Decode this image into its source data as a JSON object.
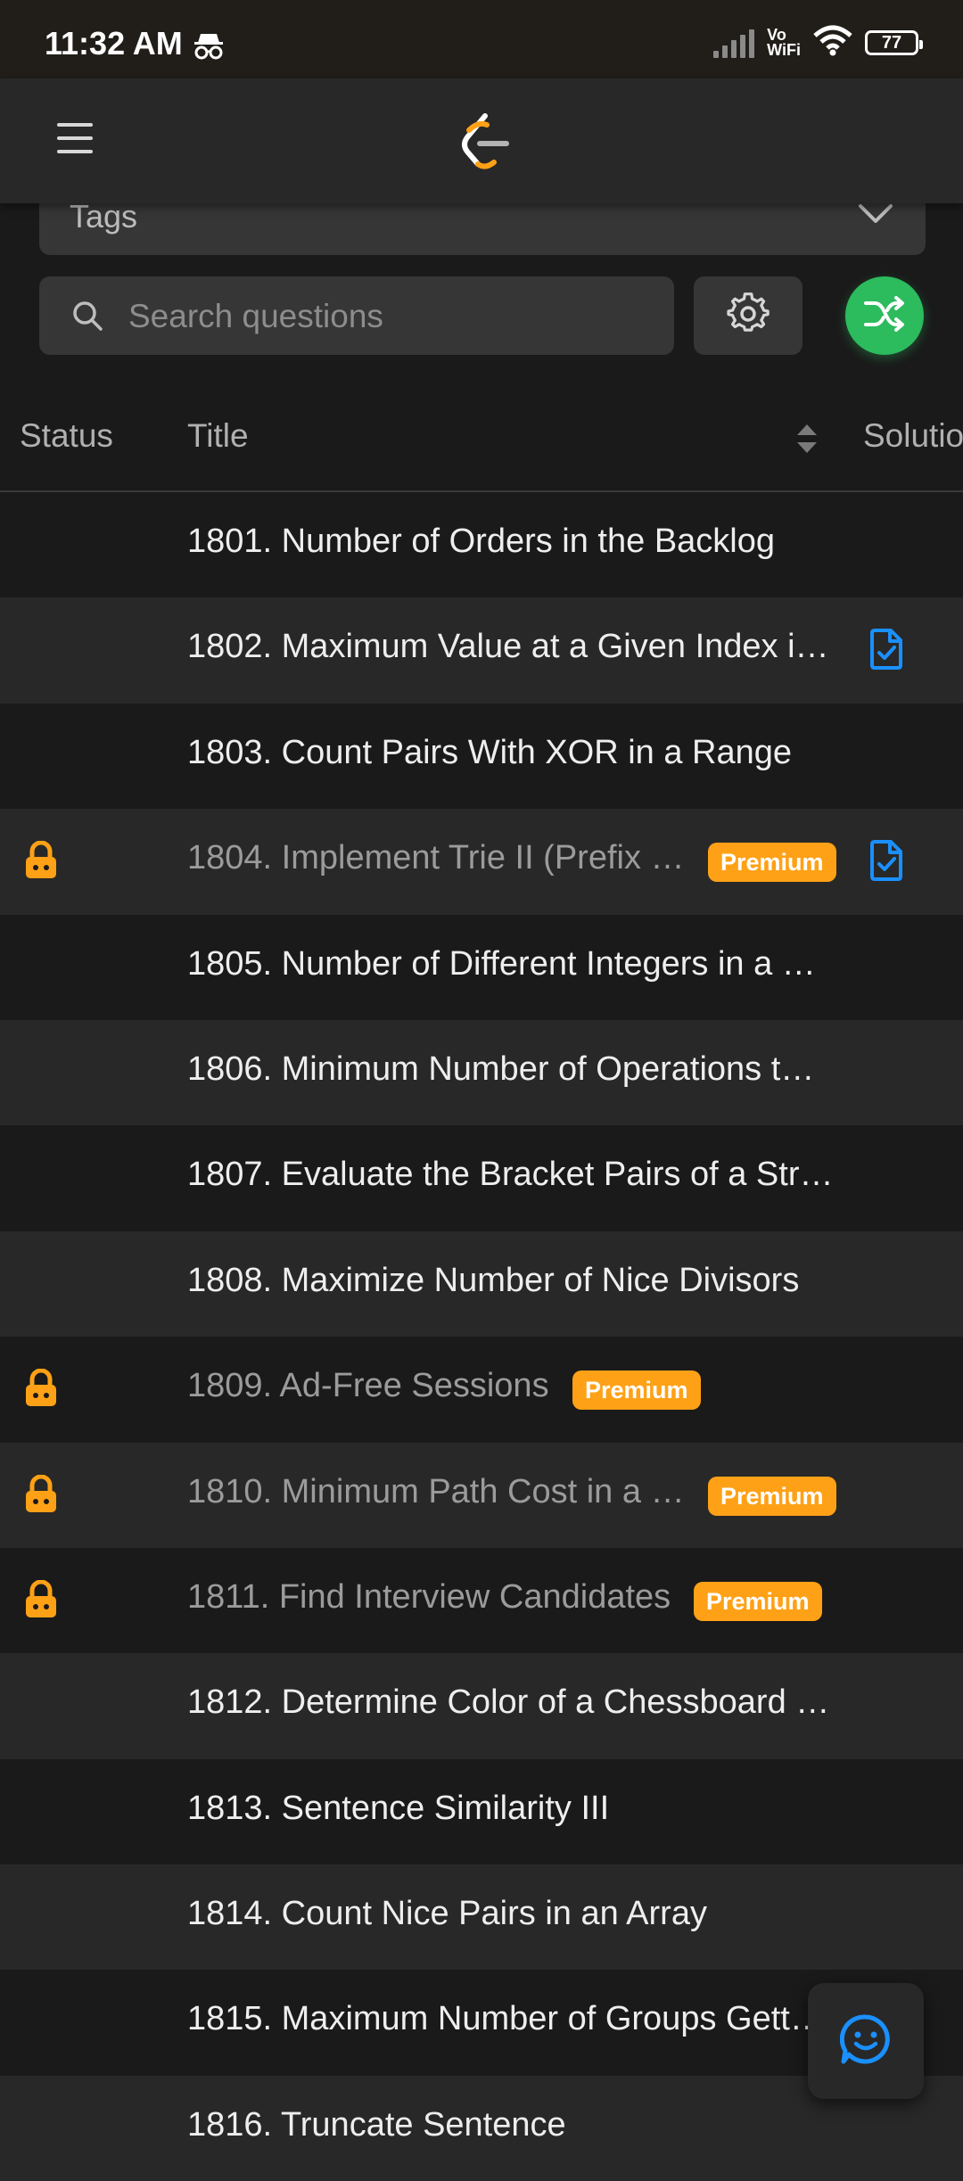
{
  "status_bar": {
    "time": "11:32 AM",
    "vo_line1": "Vo",
    "vo_line2": "WiFi",
    "battery": "77",
    "icons": [
      "incognito-icon",
      "signal-icon",
      "wifi-icon",
      "battery-icon"
    ]
  },
  "header": {
    "menu_icon": "hamburger-menu-icon",
    "logo_icon": "leetcode-logo-icon"
  },
  "filters": {
    "tags_label": "Tags",
    "search_placeholder": "Search questions",
    "search_value": ""
  },
  "table": {
    "columns": {
      "status": "Status",
      "title": "Title",
      "solution": "Solutio"
    },
    "rows": [
      {
        "title": "1801. Number of Orders in the Backlog",
        "locked": false,
        "premium": false,
        "solution": false
      },
      {
        "title": "1802. Maximum Value at a Given Index i…",
        "locked": false,
        "premium": false,
        "solution": true
      },
      {
        "title": "1803. Count Pairs With XOR in a Range",
        "locked": false,
        "premium": false,
        "solution": false
      },
      {
        "title": "1804. Implement Trie II (Prefix …",
        "locked": true,
        "premium": true,
        "solution": true
      },
      {
        "title": "1805. Number of Different Integers in a …",
        "locked": false,
        "premium": false,
        "solution": false
      },
      {
        "title": "1806. Minimum Number of Operations t…",
        "locked": false,
        "premium": false,
        "solution": false
      },
      {
        "title": "1807. Evaluate the Bracket Pairs of a Str…",
        "locked": false,
        "premium": false,
        "solution": false
      },
      {
        "title": "1808. Maximize Number of Nice Divisors",
        "locked": false,
        "premium": false,
        "solution": false
      },
      {
        "title": "1809. Ad-Free Sessions",
        "locked": true,
        "premium": true,
        "solution": false
      },
      {
        "title": "1810. Minimum Path Cost in a …",
        "locked": true,
        "premium": true,
        "solution": false
      },
      {
        "title": "1811. Find Interview Candidates",
        "locked": true,
        "premium": true,
        "solution": false
      },
      {
        "title": "1812. Determine Color of a Chessboard …",
        "locked": false,
        "premium": false,
        "solution": false
      },
      {
        "title": "1813. Sentence Similarity III",
        "locked": false,
        "premium": false,
        "solution": false
      },
      {
        "title": "1814. Count Nice Pairs in an Array",
        "locked": false,
        "premium": false,
        "solution": false
      },
      {
        "title": "1815. Maximum Number of Groups Gett…",
        "locked": false,
        "premium": false,
        "solution": false
      },
      {
        "title": "1816. Truncate Sentence",
        "locked": false,
        "premium": false,
        "solution": false
      }
    ],
    "premium_label": "Premium"
  },
  "colors": {
    "premium": "#ffa116",
    "shuffle": "#2cbb5d",
    "solution": "#1a90ff"
  }
}
